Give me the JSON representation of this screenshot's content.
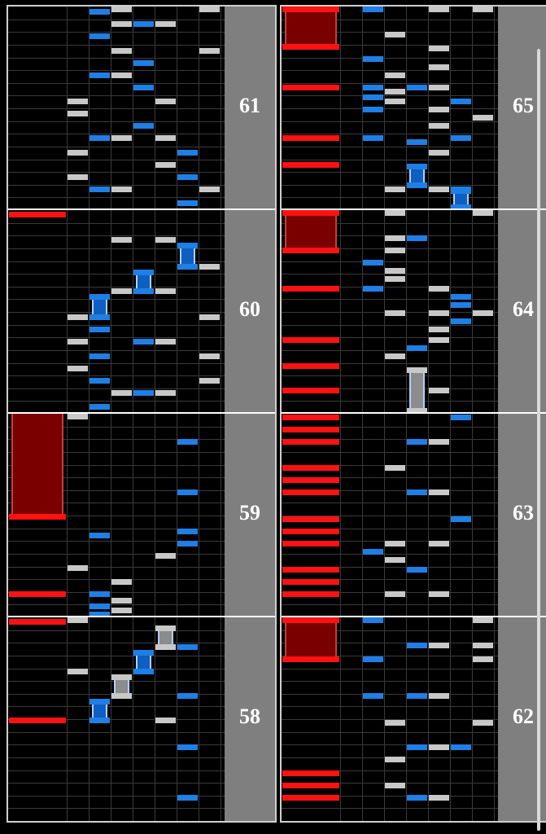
{
  "colors": {
    "background": "#000000",
    "grid": "#3a3a3a",
    "measure_line": "#ffffff",
    "number_strip": "#7f7f7f",
    "scratch": "#ff1111",
    "scratch_long": "#7a0000",
    "white_key": "#c8c8c8",
    "blue_key": "#1e7fe6",
    "long_blue_body": "#0e5fc2",
    "long_white_body": "#8c8c8c"
  },
  "lanes": [
    "scratch",
    "key1",
    "key2",
    "key3",
    "key4",
    "key5",
    "key6",
    "key7"
  ],
  "columns": [
    {
      "measures": [
        {
          "number": "61",
          "notes": [
            {
              "lane": 6,
              "pos": 0.02
            },
            {
              "lane": 7,
              "pos": 0.09
            },
            {
              "lane": 2,
              "pos": 0.09
            },
            {
              "lane": 3,
              "pos": 0.09
            },
            {
              "lane": 1,
              "pos": 0.15
            },
            {
              "lane": 6,
              "pos": 0.15
            },
            {
              "lane": 5,
              "pos": 0.21
            },
            {
              "lane": 1,
              "pos": 0.27
            },
            {
              "lane": 6,
              "pos": 0.27
            },
            {
              "lane": 2,
              "pos": 0.34
            },
            {
              "lane": 3,
              "pos": 0.34
            },
            {
              "lane": 5,
              "pos": 0.34
            },
            {
              "lane": 4,
              "pos": 0.4
            },
            {
              "lane": 1,
              "pos": 0.46
            },
            {
              "lane": 1,
              "pos": 0.52
            },
            {
              "lane": 5,
              "pos": 0.52
            },
            {
              "lane": 4,
              "pos": 0.59
            },
            {
              "lane": 2,
              "pos": 0.65
            },
            {
              "lane": 3,
              "pos": 0.65
            },
            {
              "lane": 4,
              "pos": 0.71
            },
            {
              "lane": 3,
              "pos": 0.77
            },
            {
              "lane": 7,
              "pos": 0.77
            },
            {
              "lane": 2,
              "pos": 0.84
            },
            {
              "lane": 3,
              "pos": 0.9
            },
            {
              "lane": 4,
              "pos": 0.9
            },
            {
              "lane": 5,
              "pos": 0.9
            },
            {
              "lane": 2,
              "pos": 0.96
            },
            {
              "lane": 3,
              "pos": 1.0
            },
            {
              "lane": 7,
              "pos": 1.0
            }
          ],
          "longs": []
        },
        {
          "number": "60",
          "notes": [
            {
              "lane": 2,
              "pos": 0.02
            },
            {
              "lane": 3,
              "pos": 0.09
            },
            {
              "lane": 4,
              "pos": 0.09
            },
            {
              "lane": 5,
              "pos": 0.09
            },
            {
              "lane": 2,
              "pos": 0.15
            },
            {
              "lane": 7,
              "pos": 0.15
            },
            {
              "lane": 1,
              "pos": 0.21
            },
            {
              "lane": 2,
              "pos": 0.27
            },
            {
              "lane": 7,
              "pos": 0.27
            },
            {
              "lane": 1,
              "pos": 0.34
            },
            {
              "lane": 4,
              "pos": 0.34
            },
            {
              "lane": 5,
              "pos": 0.34
            },
            {
              "lane": 2,
              "pos": 0.4
            },
            {
              "lane": 1,
              "pos": 0.46
            },
            {
              "lane": 7,
              "pos": 0.46
            },
            {
              "lane": 3,
              "pos": 0.59
            },
            {
              "lane": 5,
              "pos": 0.59
            },
            {
              "lane": 7,
              "pos": 0.71
            },
            {
              "lane": 3,
              "pos": 0.84
            },
            {
              "lane": 5,
              "pos": 0.84
            }
          ],
          "longs": [
            {
              "lane": 2,
              "start": 0.46,
              "end": 0.59,
              "kind": "blue"
            },
            {
              "lane": 4,
              "start": 0.59,
              "end": 0.71,
              "kind": "blue"
            },
            {
              "lane": 6,
              "start": 0.71,
              "end": 0.84,
              "kind": "blue"
            },
            {
              "lane": 0,
              "start": 0.965,
              "end": 1.0,
              "kind": "scratch-tap"
            }
          ]
        },
        {
          "number": "59",
          "notes": [
            {
              "lane": 2,
              "pos": 0.0
            },
            {
              "lane": 3,
              "pos": 0.02
            },
            {
              "lane": 2,
              "pos": 0.04
            },
            {
              "lane": 3,
              "pos": 0.07
            },
            {
              "lane": 0,
              "pos": 0.1
            },
            {
              "lane": 2,
              "pos": 0.1
            },
            {
              "lane": 3,
              "pos": 0.16
            },
            {
              "lane": 1,
              "pos": 0.23
            },
            {
              "lane": 5,
              "pos": 0.29
            },
            {
              "lane": 6,
              "pos": 0.35
            },
            {
              "lane": 2,
              "pos": 0.39
            },
            {
              "lane": 6,
              "pos": 0.41
            },
            {
              "lane": 6,
              "pos": 0.6
            },
            {
              "lane": 6,
              "pos": 0.85
            },
            {
              "lane": 1,
              "pos": 0.98
            }
          ],
          "longs": [
            {
              "lane": 0,
              "start": 0.48,
              "end": 1.5,
              "kind": "scratch"
            }
          ]
        },
        {
          "number": "58",
          "notes": [
            {
              "lane": 6,
              "pos": 0.1
            },
            {
              "lane": 6,
              "pos": 0.35
            },
            {
              "lane": 5,
              "pos": 0.48
            },
            {
              "lane": 6,
              "pos": 0.6
            },
            {
              "lane": 1,
              "pos": 0.72
            },
            {
              "lane": 6,
              "pos": 0.84
            },
            {
              "lane": 1,
              "pos": 1.0
            }
          ],
          "longs": [
            {
              "lane": 2,
              "start": 0.48,
              "end": 0.6,
              "kind": "blue"
            },
            {
              "lane": 3,
              "start": 0.6,
              "end": 0.72,
              "kind": "white"
            },
            {
              "lane": 4,
              "start": 0.72,
              "end": 0.84,
              "kind": "blue"
            },
            {
              "lane": 5,
              "start": 0.84,
              "end": 0.96,
              "kind": "white"
            },
            {
              "lane": 0,
              "start": 0.48,
              "end": 0.5,
              "kind": "scratch-tap"
            },
            {
              "lane": 0,
              "start": 0.965,
              "end": 1.0,
              "kind": "scratch-tap"
            }
          ]
        }
      ]
    },
    {
      "measures": [
        {
          "number": "65",
          "notes": [
            {
              "lane": 3,
              "pos": 0.09
            },
            {
              "lane": 5,
              "pos": 0.09
            },
            {
              "lane": 6,
              "pos": 0.09
            },
            {
              "lane": 0,
              "pos": 0.21
            },
            {
              "lane": 5,
              "pos": 0.27
            },
            {
              "lane": 4,
              "pos": 0.32
            },
            {
              "lane": 0,
              "pos": 0.34
            },
            {
              "lane": 2,
              "pos": 0.34
            },
            {
              "lane": 6,
              "pos": 0.34
            },
            {
              "lane": 5,
              "pos": 0.4
            },
            {
              "lane": 7,
              "pos": 0.44
            },
            {
              "lane": 2,
              "pos": 0.48
            },
            {
              "lane": 5,
              "pos": 0.48
            },
            {
              "lane": 3,
              "pos": 0.52
            },
            {
              "lane": 6,
              "pos": 0.52
            },
            {
              "lane": 2,
              "pos": 0.54
            },
            {
              "lane": 3,
              "pos": 0.57
            },
            {
              "lane": 4,
              "pos": 0.59
            },
            {
              "lane": 0,
              "pos": 0.59
            },
            {
              "lane": 2,
              "pos": 0.59
            },
            {
              "lane": 5,
              "pos": 0.59
            },
            {
              "lane": 3,
              "pos": 0.65
            },
            {
              "lane": 5,
              "pos": 0.69
            },
            {
              "lane": 2,
              "pos": 0.73
            },
            {
              "lane": 5,
              "pos": 0.78
            },
            {
              "lane": 3,
              "pos": 0.85
            },
            {
              "lane": 5,
              "pos": 1.0
            },
            {
              "lane": 7,
              "pos": 1.0
            },
            {
              "lane": 2,
              "pos": 1.0
            }
          ],
          "longs": [
            {
              "lane": 6,
              "start": 0.0,
              "end": 0.11,
              "kind": "blue"
            },
            {
              "lane": 4,
              "start": 0.11,
              "end": 0.23,
              "kind": "blue"
            },
            {
              "lane": 0,
              "start": 0.79,
              "end": 1.0,
              "kind": "scratch"
            }
          ]
        },
        {
          "number": "64",
          "notes": [
            {
              "lane": 5,
              "pos": 0.1
            },
            {
              "lane": 0,
              "pos": 0.1
            },
            {
              "lane": 0,
              "pos": 0.22
            },
            {
              "lane": 3,
              "pos": 0.27
            },
            {
              "lane": 4,
              "pos": 0.31
            },
            {
              "lane": 0,
              "pos": 0.35
            },
            {
              "lane": 5,
              "pos": 0.35
            },
            {
              "lane": 5,
              "pos": 0.4
            },
            {
              "lane": 6,
              "pos": 0.44
            },
            {
              "lane": 3,
              "pos": 0.48
            },
            {
              "lane": 5,
              "pos": 0.48
            },
            {
              "lane": 7,
              "pos": 0.48
            },
            {
              "lane": 6,
              "pos": 0.52
            },
            {
              "lane": 6,
              "pos": 0.56
            },
            {
              "lane": 0,
              "pos": 0.6
            },
            {
              "lane": 2,
              "pos": 0.6
            },
            {
              "lane": 5,
              "pos": 0.6
            },
            {
              "lane": 3,
              "pos": 0.65
            },
            {
              "lane": 3,
              "pos": 0.69
            },
            {
              "lane": 2,
              "pos": 0.73
            },
            {
              "lane": 3,
              "pos": 0.79
            },
            {
              "lane": 3,
              "pos": 0.85
            },
            {
              "lane": 4,
              "pos": 0.85
            },
            {
              "lane": 3,
              "pos": 1.0
            },
            {
              "lane": 7,
              "pos": 1.0
            }
          ],
          "longs": [
            {
              "lane": 4,
              "start": 0.0,
              "end": 0.23,
              "kind": "white"
            },
            {
              "lane": 0,
              "start": 0.79,
              "end": 1.0,
              "kind": "scratch"
            }
          ]
        },
        {
          "number": "63",
          "notes": [
            {
              "lane": 0,
              "pos": 0.1
            },
            {
              "lane": 3,
              "pos": 0.1
            },
            {
              "lane": 5,
              "pos": 0.1
            },
            {
              "lane": 0,
              "pos": 0.16
            },
            {
              "lane": 0,
              "pos": 0.22
            },
            {
              "lane": 4,
              "pos": 0.22
            },
            {
              "lane": 3,
              "pos": 0.27
            },
            {
              "lane": 2,
              "pos": 0.31
            },
            {
              "lane": 0,
              "pos": 0.35
            },
            {
              "lane": 3,
              "pos": 0.35
            },
            {
              "lane": 5,
              "pos": 0.35
            },
            {
              "lane": 0,
              "pos": 0.41
            },
            {
              "lane": 0,
              "pos": 0.47
            },
            {
              "lane": 6,
              "pos": 0.47
            },
            {
              "lane": 0,
              "pos": 0.6
            },
            {
              "lane": 4,
              "pos": 0.6
            },
            {
              "lane": 5,
              "pos": 0.6
            },
            {
              "lane": 0,
              "pos": 0.66
            },
            {
              "lane": 0,
              "pos": 0.72
            },
            {
              "lane": 3,
              "pos": 0.72
            },
            {
              "lane": 0,
              "pos": 0.85
            },
            {
              "lane": 4,
              "pos": 0.85
            },
            {
              "lane": 5,
              "pos": 0.85
            },
            {
              "lane": 0,
              "pos": 0.91
            },
            {
              "lane": 0,
              "pos": 0.97
            },
            {
              "lane": 6,
              "pos": 0.97
            }
          ],
          "longs": []
        },
        {
          "number": "62",
          "notes": [
            {
              "lane": 0,
              "pos": 0.1
            },
            {
              "lane": 4,
              "pos": 0.1
            },
            {
              "lane": 5,
              "pos": 0.1
            },
            {
              "lane": 0,
              "pos": 0.16
            },
            {
              "lane": 3,
              "pos": 0.16
            },
            {
              "lane": 0,
              "pos": 0.22
            },
            {
              "lane": 3,
              "pos": 0.29
            },
            {
              "lane": 4,
              "pos": 0.35
            },
            {
              "lane": 5,
              "pos": 0.35
            },
            {
              "lane": 6,
              "pos": 0.35
            },
            {
              "lane": 3,
              "pos": 0.47
            },
            {
              "lane": 7,
              "pos": 0.47
            },
            {
              "lane": 2,
              "pos": 0.6
            },
            {
              "lane": 4,
              "pos": 0.6
            },
            {
              "lane": 5,
              "pos": 0.6
            },
            {
              "lane": 2,
              "pos": 0.78
            },
            {
              "lane": 7,
              "pos": 0.78
            },
            {
              "lane": 4,
              "pos": 0.85
            },
            {
              "lane": 5,
              "pos": 0.85
            },
            {
              "lane": 7,
              "pos": 0.85
            },
            {
              "lane": 2,
              "pos": 1.0
            },
            {
              "lane": 7,
              "pos": 1.0
            }
          ],
          "longs": [
            {
              "lane": 0,
              "start": 0.78,
              "end": 1.0,
              "kind": "scratch"
            }
          ]
        }
      ]
    }
  ]
}
